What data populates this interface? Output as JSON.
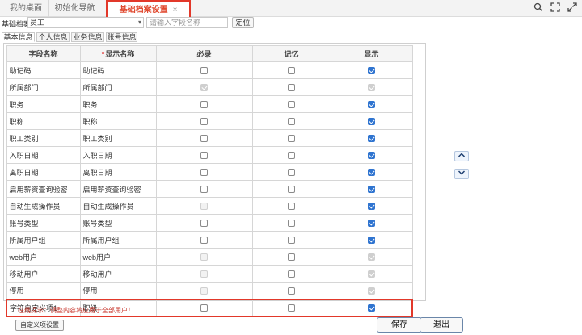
{
  "tabs": {
    "desktop": "我的桌面",
    "init_nav": "初始化导航",
    "active": "基础档案设置",
    "close": "×"
  },
  "window_icons": [
    "search-icon",
    "maximize-icon",
    "expand-icon",
    "close-icon"
  ],
  "filter": {
    "label": "基础档案",
    "select_value": "员工",
    "search_placeholder": "请输入字段名称",
    "locate_label": "定位"
  },
  "subtabs": [
    "基本信息",
    "个人信息",
    "业务信息",
    "账号信息"
  ],
  "table": {
    "headers": {
      "field_name": "字段名称",
      "display_name_marker": "*",
      "display_name": "显示名称",
      "required": "必录",
      "remember": "记忆",
      "show": "显示"
    },
    "rows": [
      {
        "field": "助记码",
        "display": "助记码",
        "required": false,
        "required_disabled": false,
        "remember": false,
        "show": true,
        "show_disabled": false
      },
      {
        "field": "所属部门",
        "display": "所属部门",
        "required": true,
        "required_disabled": true,
        "remember": false,
        "show": true,
        "show_disabled": true
      },
      {
        "field": "职务",
        "display": "职务",
        "required": false,
        "required_disabled": false,
        "remember": false,
        "show": true,
        "show_disabled": false
      },
      {
        "field": "职称",
        "display": "职称",
        "required": false,
        "required_disabled": false,
        "remember": false,
        "show": true,
        "show_disabled": false
      },
      {
        "field": "职工类别",
        "display": "职工类别",
        "required": false,
        "required_disabled": false,
        "remember": false,
        "show": true,
        "show_disabled": false
      },
      {
        "field": "入职日期",
        "display": "入职日期",
        "required": false,
        "required_disabled": false,
        "remember": false,
        "show": true,
        "show_disabled": false
      },
      {
        "field": "离职日期",
        "display": "离职日期",
        "required": false,
        "required_disabled": false,
        "remember": false,
        "show": true,
        "show_disabled": false
      },
      {
        "field": "启用薪资查询验密",
        "display": "启用薪资查询验密",
        "required": false,
        "required_disabled": false,
        "remember": false,
        "show": true,
        "show_disabled": false
      },
      {
        "field": "自动生成操作员",
        "display": "自动生成操作员",
        "required": false,
        "required_disabled": true,
        "remember": false,
        "show": true,
        "show_disabled": false
      },
      {
        "field": "账号类型",
        "display": "账号类型",
        "required": false,
        "required_disabled": false,
        "remember": false,
        "show": true,
        "show_disabled": false
      },
      {
        "field": "所属用户组",
        "display": "所属用户组",
        "required": false,
        "required_disabled": false,
        "remember": false,
        "show": true,
        "show_disabled": false
      },
      {
        "field": "web用户",
        "display": "web用户",
        "required": false,
        "required_disabled": true,
        "remember": false,
        "show": true,
        "show_disabled": true
      },
      {
        "field": "移动用户",
        "display": "移动用户",
        "required": false,
        "required_disabled": true,
        "remember": false,
        "show": true,
        "show_disabled": true
      },
      {
        "field": "停用",
        "display": "停用",
        "required": false,
        "required_disabled": true,
        "remember": false,
        "show": true,
        "show_disabled": true
      },
      {
        "field": "字符自定义项1",
        "display": "职级",
        "required": false,
        "required_disabled": false,
        "remember": false,
        "show": true,
        "show_disabled": false,
        "highlight": true
      }
    ]
  },
  "move_up": "⌃",
  "move_down": "⌄",
  "hint": "在线提示：调整内容将应用于全部用户！",
  "custom_button": "自定义项设置",
  "save_button": "保存",
  "exit_button": "退出",
  "colors": {
    "accent": "#e2382a",
    "check": "#2f74d0"
  }
}
